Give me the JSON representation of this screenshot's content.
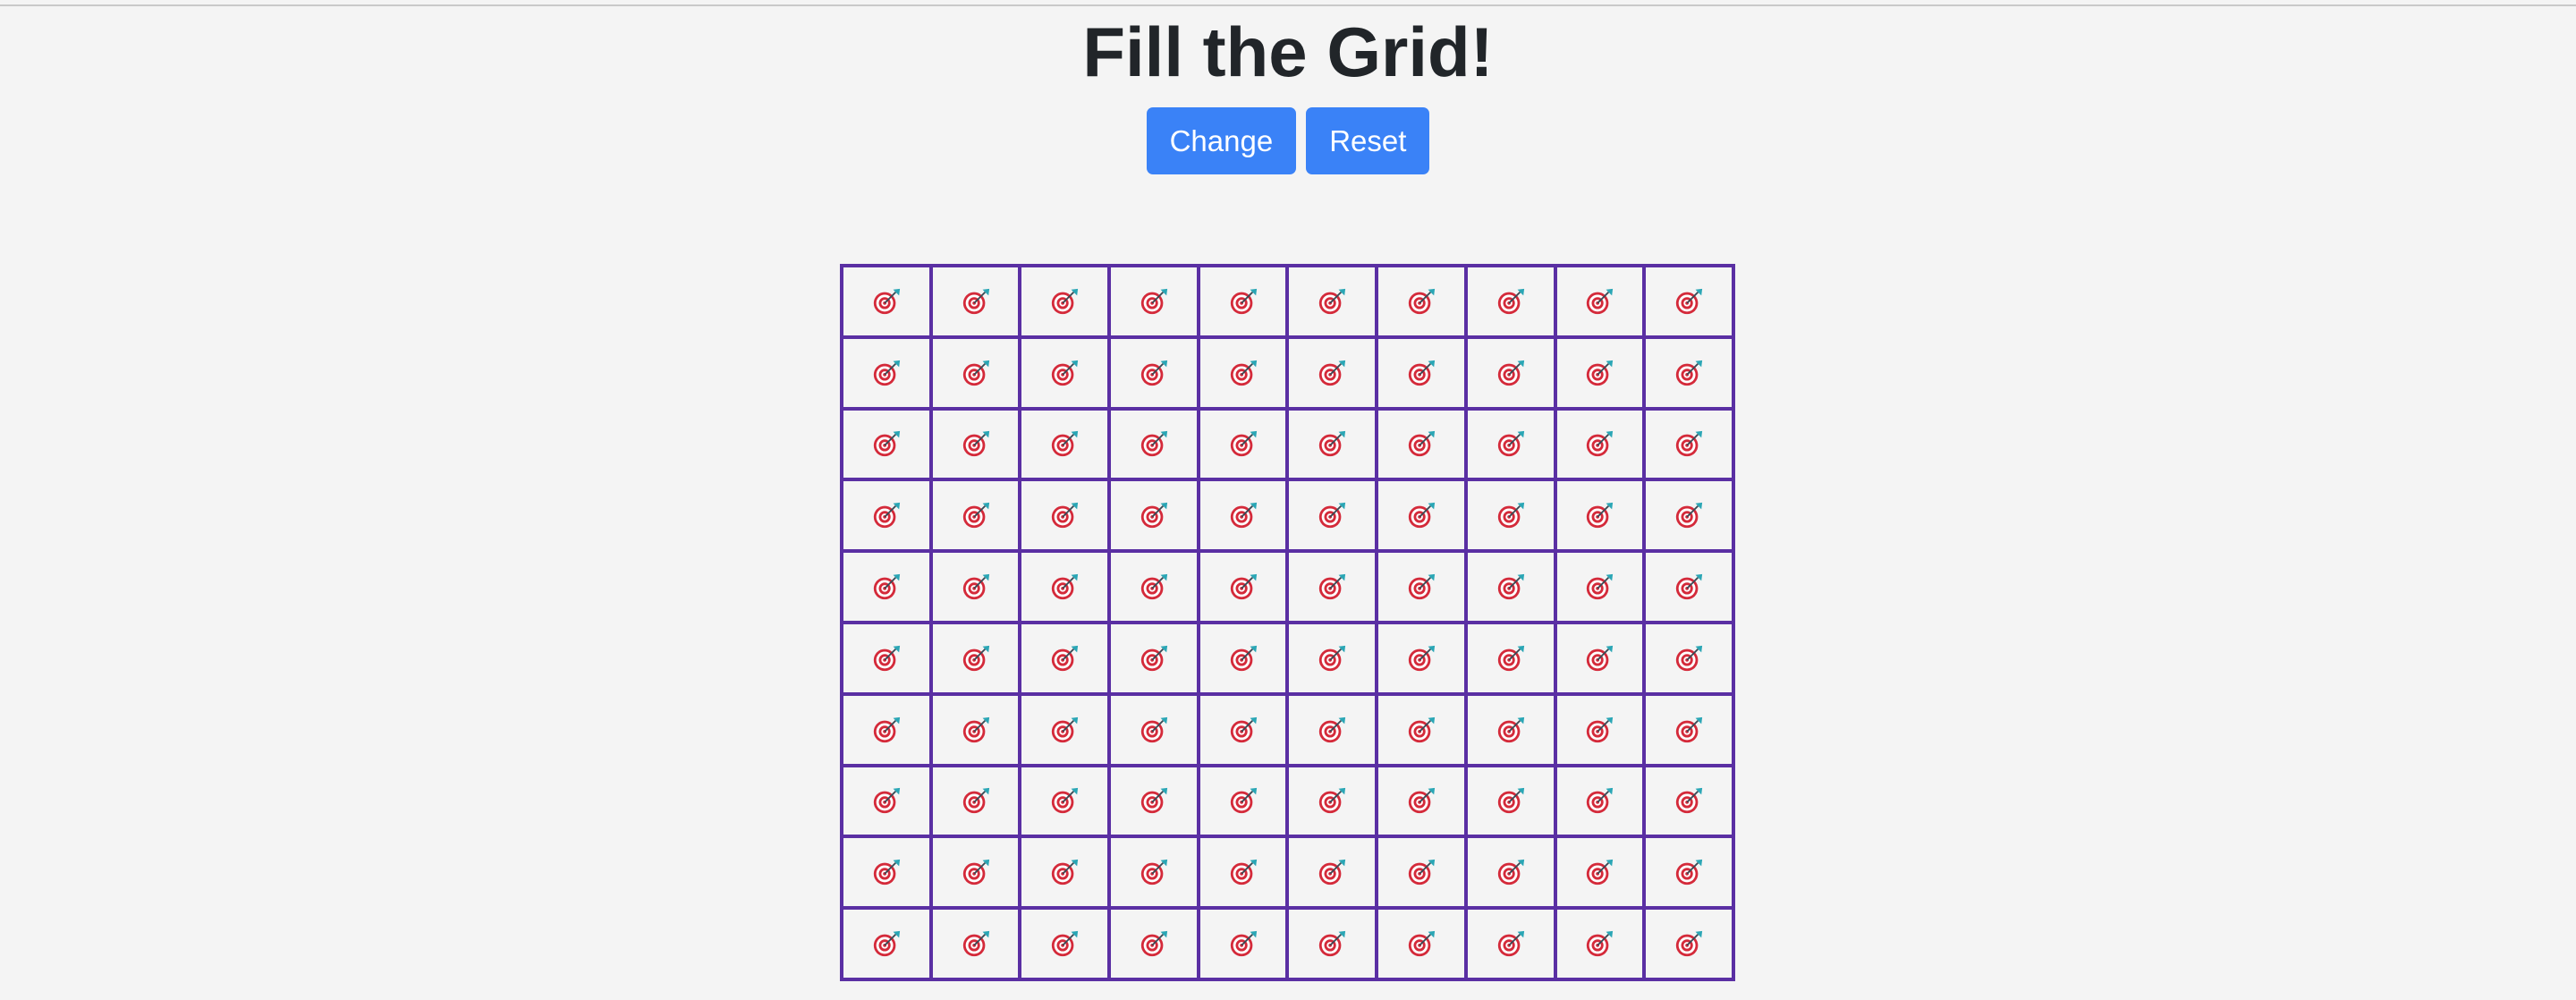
{
  "page": {
    "title": "Fill the Grid!"
  },
  "controls": {
    "change_label": "Change",
    "reset_label": "Reset"
  },
  "grid": {
    "rows": 10,
    "cols": 10,
    "cell_icon": "direct-hit-target-icon",
    "border_color": "#5a2fa3"
  },
  "colors": {
    "button": "#3a82f7",
    "background": "#f4f4f4",
    "title": "#212529"
  }
}
